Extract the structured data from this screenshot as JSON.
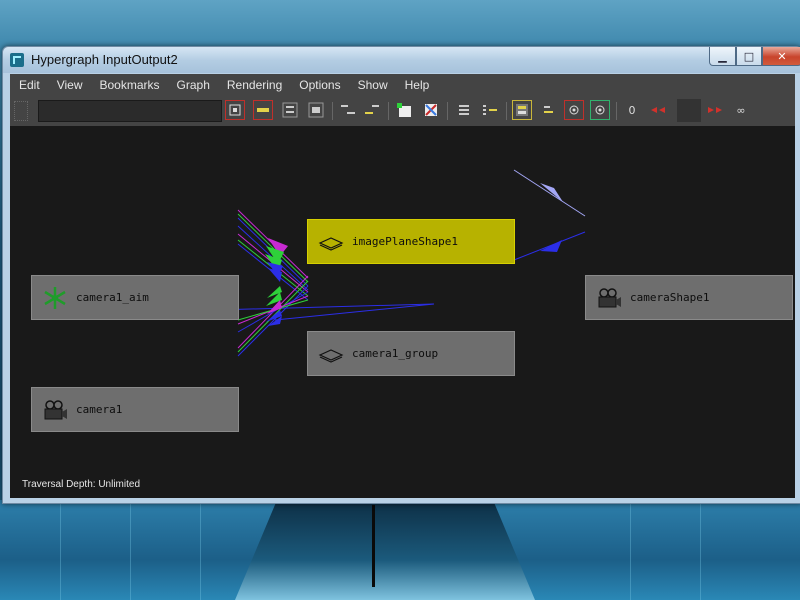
{
  "window": {
    "title": "Hypergraph InputOutput2",
    "minimize_glyph": "▁",
    "maximize_glyph": "□",
    "close_glyph": "✕"
  },
  "menus": [
    "Edit",
    "View",
    "Bookmarks",
    "Graph",
    "Rendering",
    "Options",
    "Show",
    "Help"
  ],
  "toolbar": {
    "filter_value": "",
    "buttons": [
      {
        "name": "frame-all-icon"
      },
      {
        "name": "frame-selection-icon"
      },
      {
        "name": "frame-hierarchy-icon"
      },
      {
        "name": "frame-branch-icon"
      },
      {
        "name": "previous-view-icon"
      },
      {
        "name": "next-view-icon"
      },
      {
        "name": "add-bookmark-icon"
      },
      {
        "name": "rename-bookmark-icon"
      },
      {
        "name": "scene-hierarchy-icon"
      },
      {
        "name": "input-output-connections-icon"
      },
      {
        "name": "toggle-swatches-icon"
      },
      {
        "name": "toggle-inputs-icon"
      },
      {
        "name": "show-inputs-icon"
      },
      {
        "name": "show-outputs-icon"
      },
      {
        "name": "depth-zero-icon",
        "label": "0"
      },
      {
        "name": "depth-decrease-icon"
      },
      {
        "name": "depth-increase-icon"
      },
      {
        "name": "depth-unlimited-icon",
        "label": "∞"
      }
    ]
  },
  "graph": {
    "nodes": {
      "image_plane": {
        "label": "imagePlaneShape1",
        "icon": "image-plane-icon",
        "selected": true
      },
      "camera_aim": {
        "label": "camera1_aim",
        "icon": "locator-icon"
      },
      "camera_group": {
        "label": "camera1_group",
        "icon": "group-icon"
      },
      "camera1": {
        "label": "camera1",
        "icon": "camera-icon"
      },
      "camera_shape": {
        "label": "cameraShape1",
        "icon": "camera-icon"
      }
    },
    "colors": {
      "background": "#191919",
      "node": "#6e6e6e",
      "selected_node": "#b7b200",
      "edge_blue": "#2b2ee8",
      "edge_light": "#a3a6f5",
      "edge_magenta": "#c82ad2",
      "edge_green": "#2ed13a"
    }
  },
  "status": {
    "traversal_depth": "Traversal Depth: Unlimited"
  }
}
